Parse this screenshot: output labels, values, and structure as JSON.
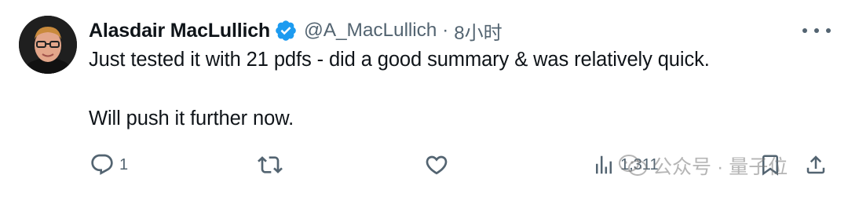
{
  "author": {
    "display_name": "Alasdair MacLullich",
    "handle": "@A_MacLullich",
    "separator": "·",
    "time": "8小时",
    "verified": true
  },
  "tweet": {
    "line1": "Just tested it with 21 pdfs - did a good summary & was relatively quick.",
    "line2": "Will push it further now."
  },
  "actions": {
    "reply_count": "1",
    "views_count": "1,311"
  },
  "watermark": {
    "text": "公众号 · 量子位"
  },
  "icons": {
    "verified": "verified-badge-icon",
    "more": "more-options-icon",
    "reply": "reply-icon",
    "retweet": "retweet-icon",
    "like": "like-icon",
    "views": "views-icon",
    "bookmark": "bookmark-icon",
    "share": "share-icon"
  },
  "colors": {
    "verified_blue": "#1d9bf0",
    "text_primary": "#0f1419",
    "text_secondary": "#536471"
  }
}
